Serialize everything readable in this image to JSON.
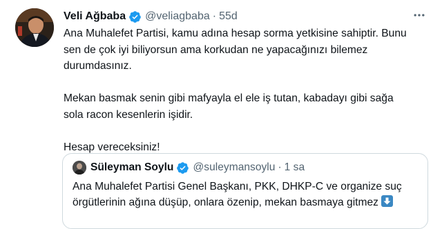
{
  "tweet": {
    "author": {
      "name": "Veli Ağbaba",
      "handle": "@veliagbaba",
      "separator": "·",
      "time": "55d",
      "more_icon": "more-horizontal-icon",
      "verified_icon": "verified-badge-icon"
    },
    "paragraphs": [
      "Ana Muhalefet Partisi, kamu adına hesap sorma yetkisine sahiptir. Bunu sen de çok iyi biliyorsun ama korkudan ne yapacağınızı bilemez durumdasınız.",
      "Mekan basmak senin gibi mafyayla el ele iş tutan, kabadayı gibi sağa sola racon kesenlerin işidir.",
      "Hesap vereceksiniz!"
    ]
  },
  "quoted": {
    "name": "Süleyman Soylu",
    "handle": "@suleymansoylu",
    "separator": "·",
    "time": "1 sa",
    "text": "Ana Muhalefet Partisi Genel Başkanı, PKK, DHKP-C ve organize suç örgütlerinin ağına düşüp, onlara özenip, mekan basmaya gitmez",
    "emoji": "down-arrow-emoji-icon"
  },
  "colors": {
    "text": "#0f1419",
    "secondary": "#536471",
    "verified": "#1d9bf0",
    "border": "#cfd9de"
  }
}
